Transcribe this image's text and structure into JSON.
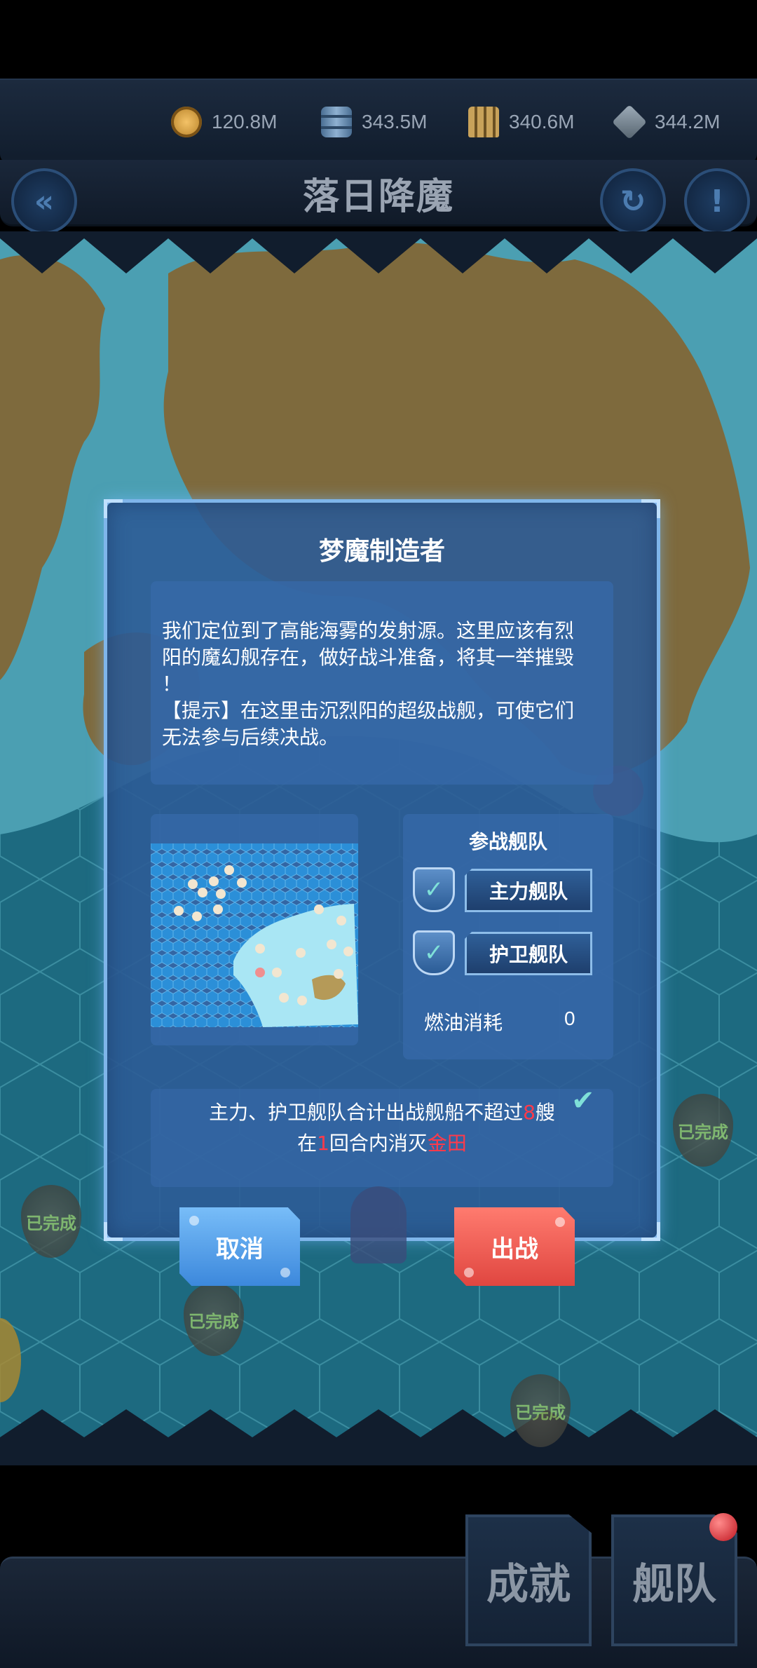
{
  "resources": [
    {
      "icon": "gold-coin-icon",
      "value": "120.8M"
    },
    {
      "icon": "oil-barrel-icon",
      "value": "343.5M"
    },
    {
      "icon": "ammo-icon",
      "value": "340.6M"
    },
    {
      "icon": "steel-icon",
      "value": "344.2M"
    }
  ],
  "header": {
    "title": "落日降魔",
    "back_glyph": "«",
    "refresh_glyph": "↻",
    "info_glyph": "!"
  },
  "map_markers": {
    "completed_label": "已完成"
  },
  "dialog": {
    "title": "梦魔制造者",
    "description_lines": [
      "我们定位到了高能海雾的发射源。这里应该有烈",
      "阳的魔幻舰存在，做好战斗准备，将其一举摧毁",
      "！",
      "【提示】在这里击沉烈阳的超级战舰，可使它们",
      "无法参与后续决战。"
    ],
    "fleet": {
      "title": "参战舰队",
      "main_fleet": "主力舰队",
      "escort_fleet": "护卫舰队",
      "fuel_label": "燃油消耗",
      "fuel_value": "0"
    },
    "conditions": {
      "line1_prefix": "主力、护卫舰队合计出战舰船不超过",
      "line1_number": "8",
      "line1_suffix": "艘",
      "line2_prefix": "在",
      "line2_number": "1",
      "line2_middle": "回合内消灭",
      "line2_target": "金田",
      "check_glyph": "✔"
    },
    "cancel_label": "取消",
    "sortie_label": "出战"
  },
  "bottom_nav": {
    "achievements_label": "成就",
    "fleet_label": "舰队"
  },
  "colors": {
    "accent": "#7fb5ea",
    "cancel": "#4a95e6",
    "sortie": "#f05a52",
    "highlight": "#ff3a4a",
    "check": "#7fe0d8"
  }
}
